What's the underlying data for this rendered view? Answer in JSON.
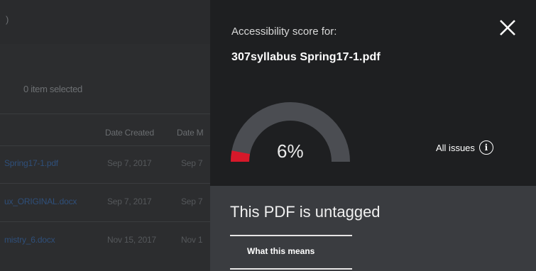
{
  "background": {
    "breadcrumb_char": ")",
    "selection": "0 item selected",
    "columns": {
      "date_created": "Date Created",
      "date_modified": "Date M"
    },
    "rows": [
      {
        "name": "Spring17-1.pdf",
        "created": "Sep 7, 2017",
        "modified": "Sep 7"
      },
      {
        "name": "ux_ORIGINAL.docx",
        "created": "Sep 7, 2017",
        "modified": "Sep 7"
      },
      {
        "name": "mistry_6.docx",
        "created": "Nov 15, 2017",
        "modified": "Nov 1"
      }
    ]
  },
  "panel": {
    "score_label": "Accessibility score for:",
    "filename": "307syllabus  Spring17-1.pdf",
    "score_percent": "6%",
    "score_value": 6,
    "all_issues_label": "All issues",
    "status_message": "This PDF is untagged",
    "what_this_means_label": "What this means",
    "colors": {
      "panel_bg": "#1e1f21",
      "gauge_track": "#4b4d52",
      "gauge_fill": "#d7182a",
      "bottom_bg": "#3a3c40"
    },
    "icons": {
      "close": "close-icon",
      "info": "info-icon"
    }
  }
}
